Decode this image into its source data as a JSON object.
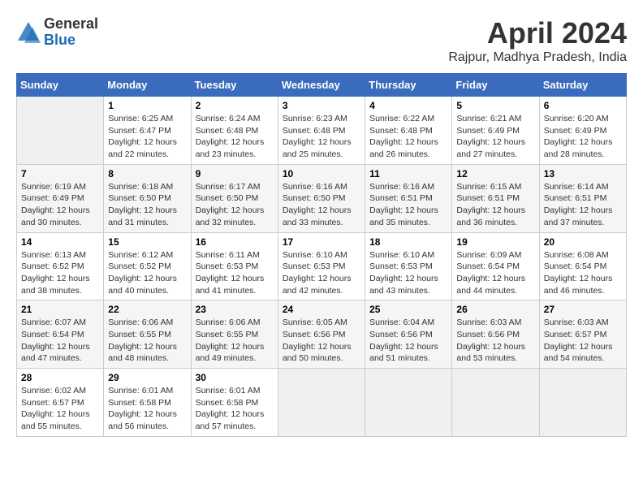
{
  "header": {
    "logo_general": "General",
    "logo_blue": "Blue",
    "title": "April 2024",
    "location": "Rajpur, Madhya Pradesh, India"
  },
  "calendar": {
    "days_of_week": [
      "Sunday",
      "Monday",
      "Tuesday",
      "Wednesday",
      "Thursday",
      "Friday",
      "Saturday"
    ],
    "weeks": [
      [
        {
          "day": "",
          "info": ""
        },
        {
          "day": "1",
          "info": "Sunrise: 6:25 AM\nSunset: 6:47 PM\nDaylight: 12 hours\nand 22 minutes."
        },
        {
          "day": "2",
          "info": "Sunrise: 6:24 AM\nSunset: 6:48 PM\nDaylight: 12 hours\nand 23 minutes."
        },
        {
          "day": "3",
          "info": "Sunrise: 6:23 AM\nSunset: 6:48 PM\nDaylight: 12 hours\nand 25 minutes."
        },
        {
          "day": "4",
          "info": "Sunrise: 6:22 AM\nSunset: 6:48 PM\nDaylight: 12 hours\nand 26 minutes."
        },
        {
          "day": "5",
          "info": "Sunrise: 6:21 AM\nSunset: 6:49 PM\nDaylight: 12 hours\nand 27 minutes."
        },
        {
          "day": "6",
          "info": "Sunrise: 6:20 AM\nSunset: 6:49 PM\nDaylight: 12 hours\nand 28 minutes."
        }
      ],
      [
        {
          "day": "7",
          "info": "Sunrise: 6:19 AM\nSunset: 6:49 PM\nDaylight: 12 hours\nand 30 minutes."
        },
        {
          "day": "8",
          "info": "Sunrise: 6:18 AM\nSunset: 6:50 PM\nDaylight: 12 hours\nand 31 minutes."
        },
        {
          "day": "9",
          "info": "Sunrise: 6:17 AM\nSunset: 6:50 PM\nDaylight: 12 hours\nand 32 minutes."
        },
        {
          "day": "10",
          "info": "Sunrise: 6:16 AM\nSunset: 6:50 PM\nDaylight: 12 hours\nand 33 minutes."
        },
        {
          "day": "11",
          "info": "Sunrise: 6:16 AM\nSunset: 6:51 PM\nDaylight: 12 hours\nand 35 minutes."
        },
        {
          "day": "12",
          "info": "Sunrise: 6:15 AM\nSunset: 6:51 PM\nDaylight: 12 hours\nand 36 minutes."
        },
        {
          "day": "13",
          "info": "Sunrise: 6:14 AM\nSunset: 6:51 PM\nDaylight: 12 hours\nand 37 minutes."
        }
      ],
      [
        {
          "day": "14",
          "info": "Sunrise: 6:13 AM\nSunset: 6:52 PM\nDaylight: 12 hours\nand 38 minutes."
        },
        {
          "day": "15",
          "info": "Sunrise: 6:12 AM\nSunset: 6:52 PM\nDaylight: 12 hours\nand 40 minutes."
        },
        {
          "day": "16",
          "info": "Sunrise: 6:11 AM\nSunset: 6:53 PM\nDaylight: 12 hours\nand 41 minutes."
        },
        {
          "day": "17",
          "info": "Sunrise: 6:10 AM\nSunset: 6:53 PM\nDaylight: 12 hours\nand 42 minutes."
        },
        {
          "day": "18",
          "info": "Sunrise: 6:10 AM\nSunset: 6:53 PM\nDaylight: 12 hours\nand 43 minutes."
        },
        {
          "day": "19",
          "info": "Sunrise: 6:09 AM\nSunset: 6:54 PM\nDaylight: 12 hours\nand 44 minutes."
        },
        {
          "day": "20",
          "info": "Sunrise: 6:08 AM\nSunset: 6:54 PM\nDaylight: 12 hours\nand 46 minutes."
        }
      ],
      [
        {
          "day": "21",
          "info": "Sunrise: 6:07 AM\nSunset: 6:54 PM\nDaylight: 12 hours\nand 47 minutes."
        },
        {
          "day": "22",
          "info": "Sunrise: 6:06 AM\nSunset: 6:55 PM\nDaylight: 12 hours\nand 48 minutes."
        },
        {
          "day": "23",
          "info": "Sunrise: 6:06 AM\nSunset: 6:55 PM\nDaylight: 12 hours\nand 49 minutes."
        },
        {
          "day": "24",
          "info": "Sunrise: 6:05 AM\nSunset: 6:56 PM\nDaylight: 12 hours\nand 50 minutes."
        },
        {
          "day": "25",
          "info": "Sunrise: 6:04 AM\nSunset: 6:56 PM\nDaylight: 12 hours\nand 51 minutes."
        },
        {
          "day": "26",
          "info": "Sunrise: 6:03 AM\nSunset: 6:56 PM\nDaylight: 12 hours\nand 53 minutes."
        },
        {
          "day": "27",
          "info": "Sunrise: 6:03 AM\nSunset: 6:57 PM\nDaylight: 12 hours\nand 54 minutes."
        }
      ],
      [
        {
          "day": "28",
          "info": "Sunrise: 6:02 AM\nSunset: 6:57 PM\nDaylight: 12 hours\nand 55 minutes."
        },
        {
          "day": "29",
          "info": "Sunrise: 6:01 AM\nSunset: 6:58 PM\nDaylight: 12 hours\nand 56 minutes."
        },
        {
          "day": "30",
          "info": "Sunrise: 6:01 AM\nSunset: 6:58 PM\nDaylight: 12 hours\nand 57 minutes."
        },
        {
          "day": "",
          "info": ""
        },
        {
          "day": "",
          "info": ""
        },
        {
          "day": "",
          "info": ""
        },
        {
          "day": "",
          "info": ""
        }
      ]
    ]
  }
}
